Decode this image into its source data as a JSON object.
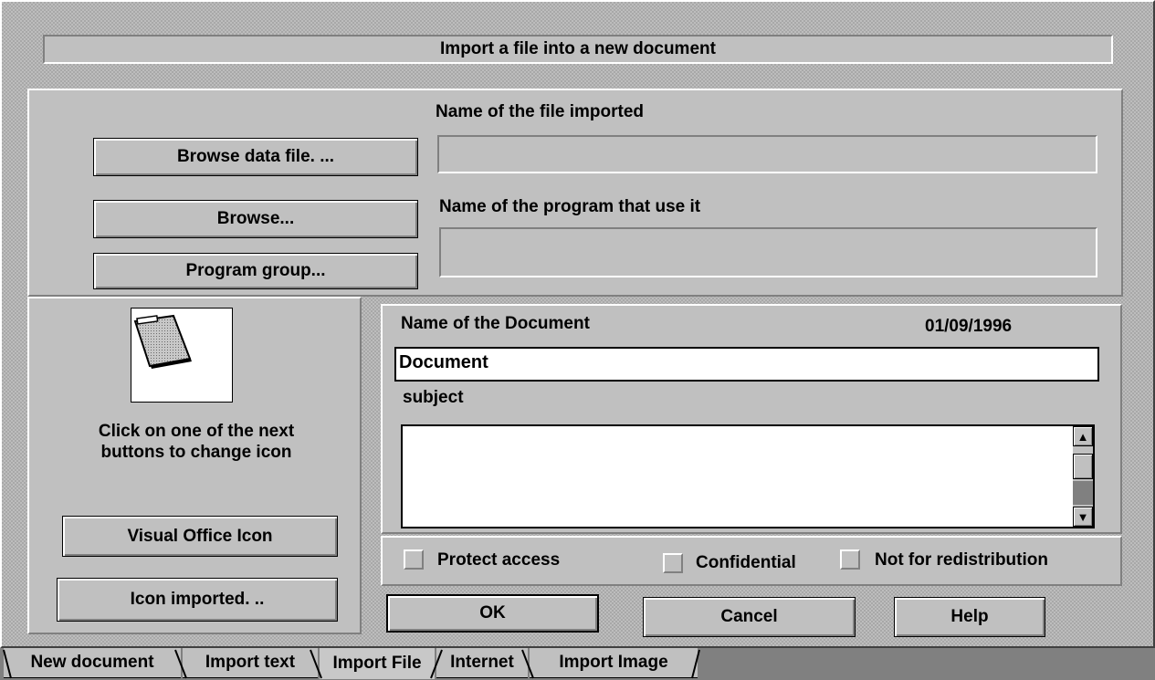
{
  "header": {
    "title": "Import a file into a new document"
  },
  "top": {
    "file_label": "Name of the file imported",
    "browse_data_button": "Browse data file. ...",
    "program_label": "Name of the program that use it",
    "browse_button": "Browse...",
    "program_group_button": "Program group...",
    "file_value": "",
    "program_value": ""
  },
  "icon_panel": {
    "icon": "folder-document-icon",
    "instructions_line1": "Click on one of the next",
    "instructions_line2": "buttons to change icon",
    "visual_office_button": "Visual Office Icon",
    "icon_imported_button": "Icon imported.  .."
  },
  "document": {
    "name_label": "Name of the Document",
    "date": "01/09/1996",
    "name_value": "Document",
    "subject_label": "subject",
    "subject_value": ""
  },
  "options": {
    "protect_access": "Protect access",
    "confidential": "Confidential",
    "not_for_redistribution": "Not for redistribution"
  },
  "actions": {
    "ok": "OK",
    "cancel": "Cancel",
    "help": "Help"
  },
  "tabs": [
    "New document",
    "Import text",
    "Import File",
    "Internet",
    "Import Image"
  ],
  "active_tab": "Import File"
}
